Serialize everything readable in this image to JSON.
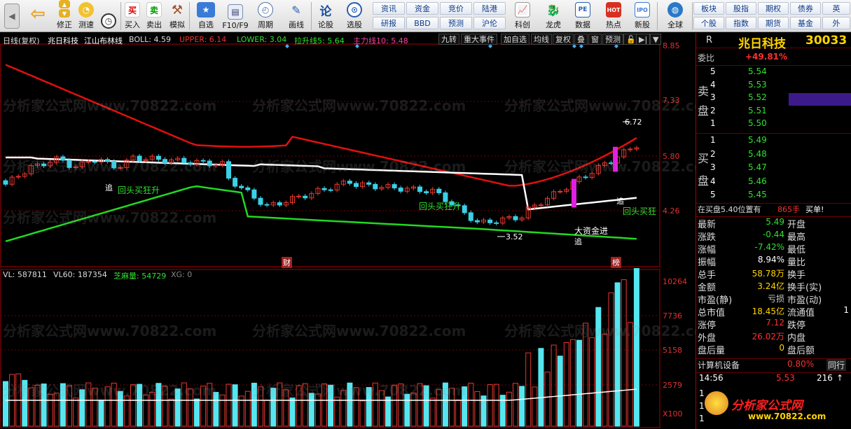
{
  "toolbar": {
    "items": [
      {
        "label": "修正"
      },
      {
        "label": "测速"
      },
      {
        "label": "买入",
        "glyph": "买"
      },
      {
        "label": "卖出",
        "glyph": "卖"
      },
      {
        "label": "模拟"
      },
      {
        "label": "自选"
      },
      {
        "label": "F10/F9"
      },
      {
        "label": "周期"
      },
      {
        "label": "画线"
      },
      {
        "label": "论股",
        "glyph": "论"
      },
      {
        "label": "选股"
      }
    ],
    "grid_top": [
      "资讯",
      "资金",
      "竞价",
      "陆港"
    ],
    "grid_bottom": [
      "研报",
      "BBD",
      "预测",
      "沪伦"
    ],
    "items2": [
      {
        "label": "科创"
      },
      {
        "label": "龙虎"
      },
      {
        "label": "数据",
        "glyph": "PE"
      },
      {
        "label": "热点",
        "glyph": "HOT"
      },
      {
        "label": "新股",
        "glyph": "IPO"
      },
      {
        "label": "全球"
      }
    ],
    "grid2_top": [
      "板块",
      "股指",
      "期权",
      "债券",
      "英"
    ],
    "grid2_bottom": [
      "个股",
      "指数",
      "期货",
      "基金",
      "外"
    ]
  },
  "chart": {
    "header": {
      "period": "日线(复权)",
      "stock": "兆日科技",
      "indicator": "江山布林线",
      "boll": "BOLL: 4.59",
      "upper": "UPPER: 6.14",
      "lower": "LOWER: 3.04",
      "lsx": "拉升线5: 5.64",
      "zlx": "主力线10: 5.48"
    },
    "buttons": [
      "九转",
      "重大事件",
      "加自选",
      "均线",
      "复权",
      "叠",
      "窗",
      "预测"
    ],
    "price_axis": [
      "8.85",
      "7.33",
      "5.80",
      "4.26"
    ],
    "annotations": {
      "high": "6.72",
      "low": "3.52",
      "zhui1": "追",
      "hui1": "回头买狂升",
      "hui2": "回头买狂升",
      "zhui2": "追",
      "hui3": "回头买狂",
      "big": "大资金进",
      "zhui3": "追",
      "cai": "财",
      "bang": "榜"
    },
    "vol_header": {
      "vl": "VL: 587811",
      "vl60": "VL60: 187354",
      "zmk": "芝麻量: 54729",
      "xg": "XG: 0"
    },
    "vol_axis": [
      "10264",
      "7736",
      "5158",
      "2579",
      "X100"
    ],
    "watermark": "分析家公式网www.70822.com",
    "colors": {
      "upper": "#e01010",
      "mid": "#ffffff",
      "lower": "#22d822",
      "up": "#e8382f",
      "down": "#3ad0e8",
      "vol": "#55e6f0"
    }
  },
  "panel": {
    "top_label": "R",
    "name": "兆日科技",
    "code": "30033",
    "wb_label": "委比",
    "wb_value": "+49.81%",
    "sell_label1": "卖",
    "sell_label2": "盘",
    "buy_label1": "买",
    "buy_label2": "盘",
    "sells": [
      {
        "n": "5",
        "p": "5.54"
      },
      {
        "n": "4",
        "p": "5.53"
      },
      {
        "n": "3",
        "p": "5.52"
      },
      {
        "n": "2",
        "p": "5.51"
      },
      {
        "n": "1",
        "p": "5.50"
      }
    ],
    "buys": [
      {
        "n": "1",
        "p": "5.49"
      },
      {
        "n": "2",
        "p": "5.48"
      },
      {
        "n": "3",
        "p": "5.47"
      },
      {
        "n": "4",
        "p": "5.46"
      },
      {
        "n": "5",
        "p": "5.45"
      }
    ],
    "notice": {
      "text": "在买盘5.40位置有",
      "qty": "865手",
      "act": "买单!"
    },
    "stats": [
      {
        "l": "最新",
        "v": "5.49",
        "l2": "开盘",
        "v2": ""
      },
      {
        "l": "涨跌",
        "v": "-0.44",
        "l2": "最高",
        "v2": ""
      },
      {
        "l": "涨幅",
        "v": "-7.42%",
        "l2": "最低",
        "v2": ""
      },
      {
        "l": "振幅",
        "v": "8.94%",
        "l2": "量比",
        "v2": ""
      },
      {
        "l": "总手",
        "v": "58.78万",
        "l2": "换手",
        "v2": ""
      },
      {
        "l": "金额",
        "v": "3.24亿",
        "l2": "换手(实)",
        "v2": ""
      },
      {
        "l": "市盈(静)",
        "v": "亏损",
        "l2": "市盈(动)",
        "v2": ""
      },
      {
        "l": "总市值",
        "v": "18.45亿",
        "l2": "流通值",
        "v2": "1"
      },
      {
        "l": "涨停",
        "v": "7.12",
        "l2": "跌停",
        "v2": ""
      },
      {
        "l": "外盘",
        "v": "26.02万",
        "l2": "内盘",
        "v2": ""
      },
      {
        "l": "盘后量",
        "v": "0",
        "l2": "盘后额",
        "v2": ""
      }
    ],
    "sector": {
      "name": "计算机设备",
      "pct": "0.80%",
      "tag": "同行"
    },
    "tick": {
      "time": "14:56",
      "price": "5.53",
      "vol": "216"
    },
    "logo": "分析家公式网",
    "logo_url": "www.70822.com"
  }
}
